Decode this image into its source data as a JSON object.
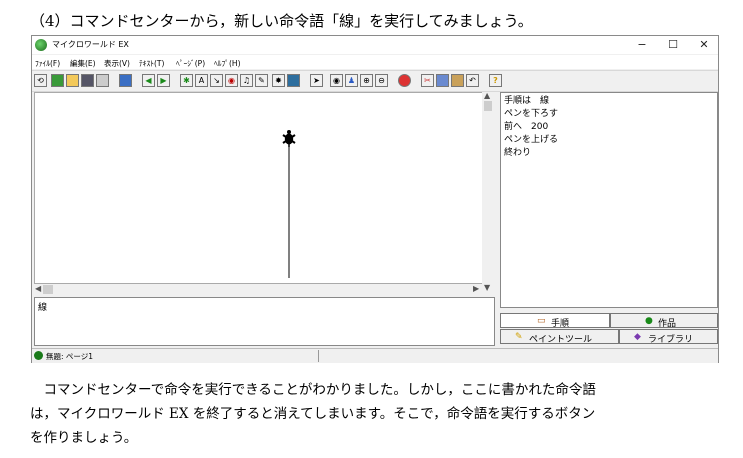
{
  "heading": "（4）コマンドセンターから，新しい命令語「線」を実行してみましょう。",
  "window": {
    "title": "マイクロワールド EX",
    "controls": {
      "minimize": "−",
      "maximize": "☐",
      "close": "✕"
    },
    "menu": [
      "ﾌｧｲﾙ(F)",
      "編集(E)",
      "表示(V)",
      "ﾃｷｽﾄ(T)",
      "ﾍﾟｰｼﾞ(P)",
      "ﾍﾙﾌﾟ(H)"
    ],
    "help_button": "?",
    "command_center_text": "線",
    "procedure_text": "手順は　線\nペンを下ろす\n前へ　200\nペンを上げる\n終わり",
    "tabs": {
      "procedures": "手順",
      "works": "作品",
      "paint_tools": "ペイントツール",
      "library": "ライブラリ"
    },
    "status": "無題: ページ1"
  },
  "paragraph_lines": [
    "　コマンドセンターで命令を実行できることがわかりました。しかし，ここに書かれた命令語",
    "は，マイクロワールド EX を終了すると消えてしまいます。そこで，命令語を実行するボタン",
    "を作りましょう。"
  ]
}
